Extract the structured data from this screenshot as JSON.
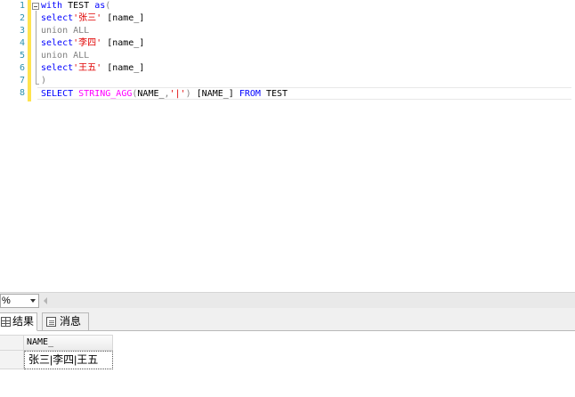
{
  "editor": {
    "line_numbers": [
      "1",
      "2",
      "3",
      "4",
      "5",
      "6",
      "7",
      "8"
    ],
    "lines": [
      [
        {
          "t": "with",
          "c": "kw"
        },
        {
          "t": " TEST ",
          "c": "tx"
        },
        {
          "t": "as",
          "c": "kw"
        },
        {
          "t": "(",
          "c": "gr"
        }
      ],
      [
        {
          "t": "select",
          "c": "kw"
        },
        {
          "t": "'张三'",
          "c": "str"
        },
        {
          "t": " [name_]",
          "c": "tx"
        }
      ],
      [
        {
          "t": "union ALL",
          "c": "gr"
        }
      ],
      [
        {
          "t": "select",
          "c": "kw"
        },
        {
          "t": "'李四'",
          "c": "str"
        },
        {
          "t": " [name_]",
          "c": "tx"
        }
      ],
      [
        {
          "t": "union ALL",
          "c": "gr"
        }
      ],
      [
        {
          "t": "select",
          "c": "kw"
        },
        {
          "t": "'王五'",
          "c": "str"
        },
        {
          "t": " [name_]",
          "c": "tx"
        }
      ],
      [
        {
          "t": ")",
          "c": "gr"
        }
      ],
      [
        {
          "t": "SELECT",
          "c": "kw"
        },
        {
          "t": " ",
          "c": "tx"
        },
        {
          "t": "STRING_AGG",
          "c": "fn"
        },
        {
          "t": "(",
          "c": "gr"
        },
        {
          "t": "NAME_",
          "c": "tx"
        },
        {
          "t": ",",
          "c": "gr"
        },
        {
          "t": "'|'",
          "c": "str"
        },
        {
          "t": ")",
          "c": "gr"
        },
        {
          "t": " [NAME_] ",
          "c": "tx"
        },
        {
          "t": "FROM",
          "c": "kw"
        },
        {
          "t": " TEST",
          "c": "tx"
        }
      ]
    ]
  },
  "zoom": {
    "value": "%"
  },
  "tabs": {
    "results_label": "结果",
    "messages_label": "消息"
  },
  "grid": {
    "column_header": "NAME_",
    "rows": [
      [
        "张三|李四|王五"
      ]
    ]
  },
  "colors": {
    "keyword": "#0000ff",
    "function": "#ff00ff",
    "string": "#e00000",
    "comment_gray": "#808080",
    "line_number": "#2b91af",
    "change_bar": "#ffe34d"
  }
}
